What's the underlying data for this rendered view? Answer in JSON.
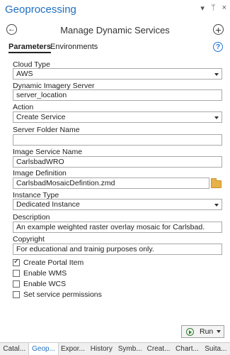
{
  "window": {
    "title": "Geoprocessing",
    "controls": [
      "▾",
      "ᛘ",
      "×"
    ]
  },
  "header": {
    "title": "Manage Dynamic Services",
    "back_icon": "back-arrow-icon",
    "add_icon": "plus-icon"
  },
  "tabs": {
    "parameters": "Parameters",
    "environments": "Environments",
    "help": "?"
  },
  "form": {
    "cloud_type": {
      "label": "Cloud Type",
      "value": "AWS"
    },
    "dynamic_imagery_server": {
      "label": "Dynamic Imagery Server",
      "value": "server_location"
    },
    "action": {
      "label": "Action",
      "value": "Create Service"
    },
    "server_folder_name": {
      "label": "Server Folder Name",
      "value": ""
    },
    "image_service_name": {
      "label": "Image Service Name",
      "value": "CarlsbadWRO"
    },
    "image_definition": {
      "label": "Image Definition",
      "value": "CarlsbadMosaicDefintion.zmd"
    },
    "instance_type": {
      "label": "Instance Type",
      "value": "Dedicated Instance"
    },
    "description": {
      "label": "Description",
      "value": "An example weighted raster overlay mosaic for Carlsbad."
    },
    "copyright": {
      "label": "Copyright",
      "value": "For educational and trainig purposes only."
    }
  },
  "checkboxes": [
    {
      "label": "Create Portal Item",
      "checked": true
    },
    {
      "label": "Enable WMS",
      "checked": false
    },
    {
      "label": "Enable WCS",
      "checked": false
    },
    {
      "label": "Set service permissions",
      "checked": false
    }
  ],
  "run_button": {
    "label": "Run"
  },
  "bottom_tabs": [
    "Catal...",
    "Geop...",
    "Expor...",
    "History",
    "Symb...",
    "Creat...",
    "Chart...",
    "Suita..."
  ],
  "colors": {
    "accent": "#1f6fc0"
  }
}
